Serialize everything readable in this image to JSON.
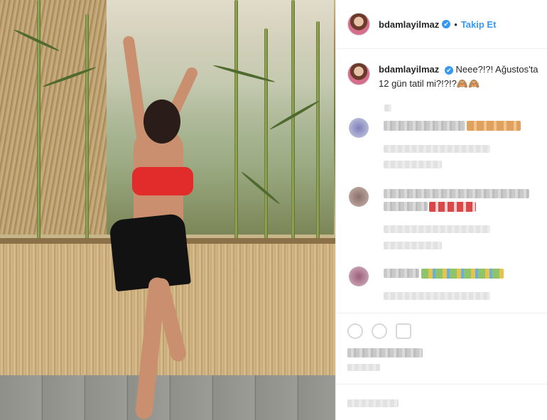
{
  "post": {
    "username": "bdamlayilmaz",
    "verified_mark": "✔",
    "separator": "•",
    "follow_label": "Takip Et",
    "caption_text": "Neee?!?! Ağustos'ta 12 gün tatil mi?!?!?",
    "caption_emoji": "🙈🙈"
  },
  "icons": {
    "avatar": "profile-avatar",
    "like": "heart-icon",
    "comment": "comment-icon",
    "share": "share-icon"
  },
  "colors": {
    "link_blue": "#3897f0",
    "text": "#262626",
    "border": "#efefef"
  }
}
